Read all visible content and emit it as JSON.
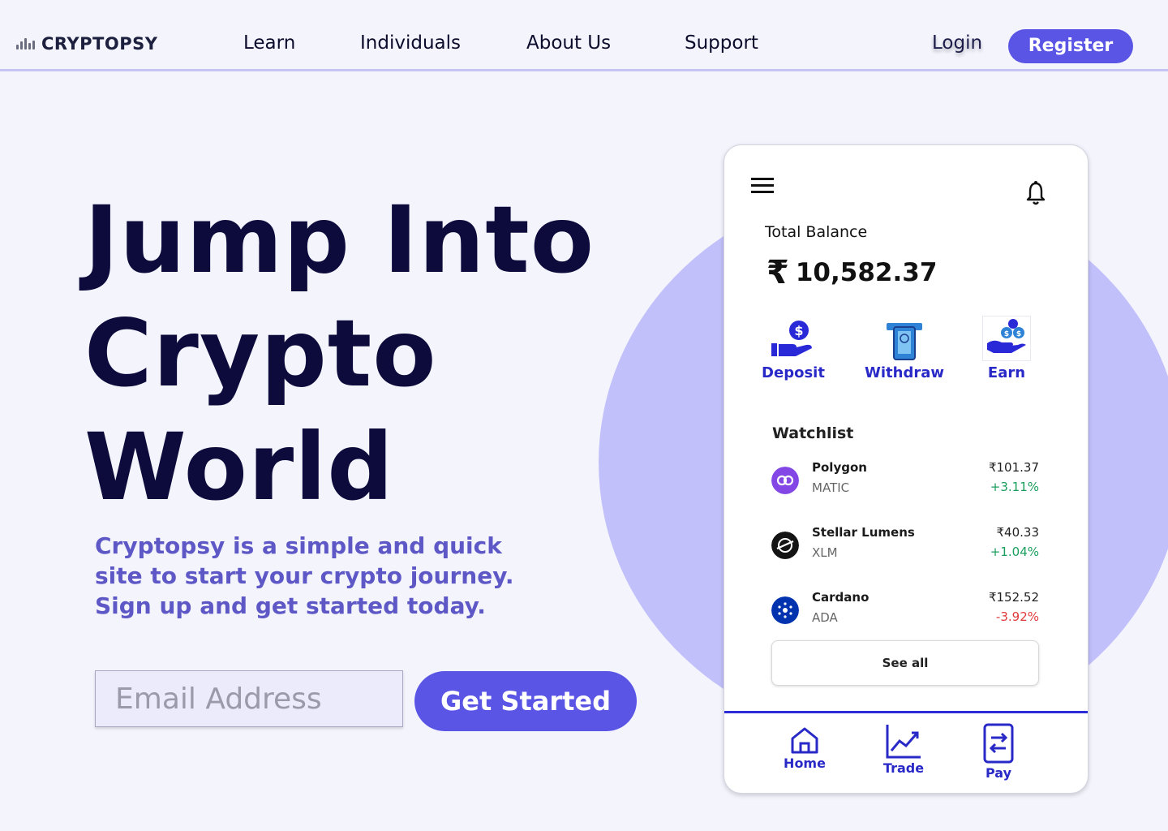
{
  "nav": {
    "brand": "CRYPTOPSY",
    "links": [
      "Learn",
      "Individuals",
      "About Us",
      "Support"
    ],
    "login": "Login",
    "register": "Register"
  },
  "hero": {
    "title_lines": [
      "Jump Into",
      "Crypto",
      "World"
    ],
    "subtitle": "Cryptopsy is a simple and quick site to start your crypto journey. Sign up and get started today.",
    "email_placeholder": "Email Address",
    "cta": "Get Started"
  },
  "phone": {
    "balance_label": "Total Balance",
    "currency_symbol": "₹",
    "balance_value": "10,582.37",
    "actions": [
      {
        "label": "Deposit",
        "icon": "deposit-icon"
      },
      {
        "label": "Withdraw",
        "icon": "withdraw-icon"
      },
      {
        "label": "Earn",
        "icon": "earn-icon"
      }
    ],
    "watchlist_title": "Watchlist",
    "coins": [
      {
        "name": "Polygon",
        "symbol": "MATIC",
        "price": "₹101.37",
        "change": "+3.11%",
        "trend": "up",
        "color": "#8247e5"
      },
      {
        "name": "Stellar Lumens",
        "symbol": "XLM",
        "price": "₹40.33",
        "change": "+1.04%",
        "trend": "up",
        "color": "#141414"
      },
      {
        "name": "Cardano",
        "symbol": "ADA",
        "price": "₹152.52",
        "change": "-3.92%",
        "trend": "down",
        "color": "#0033ad"
      }
    ],
    "see_all": "See all",
    "tabs": [
      {
        "label": "Home",
        "icon": "home-icon"
      },
      {
        "label": "Trade",
        "icon": "trade-chart-icon"
      },
      {
        "label": "Pay",
        "icon": "pay-icon"
      }
    ]
  },
  "colors": {
    "accent": "#5b55e6",
    "positive": "#1a9e5c",
    "negative": "#e03a3a",
    "circle": "#c2c0fa"
  }
}
